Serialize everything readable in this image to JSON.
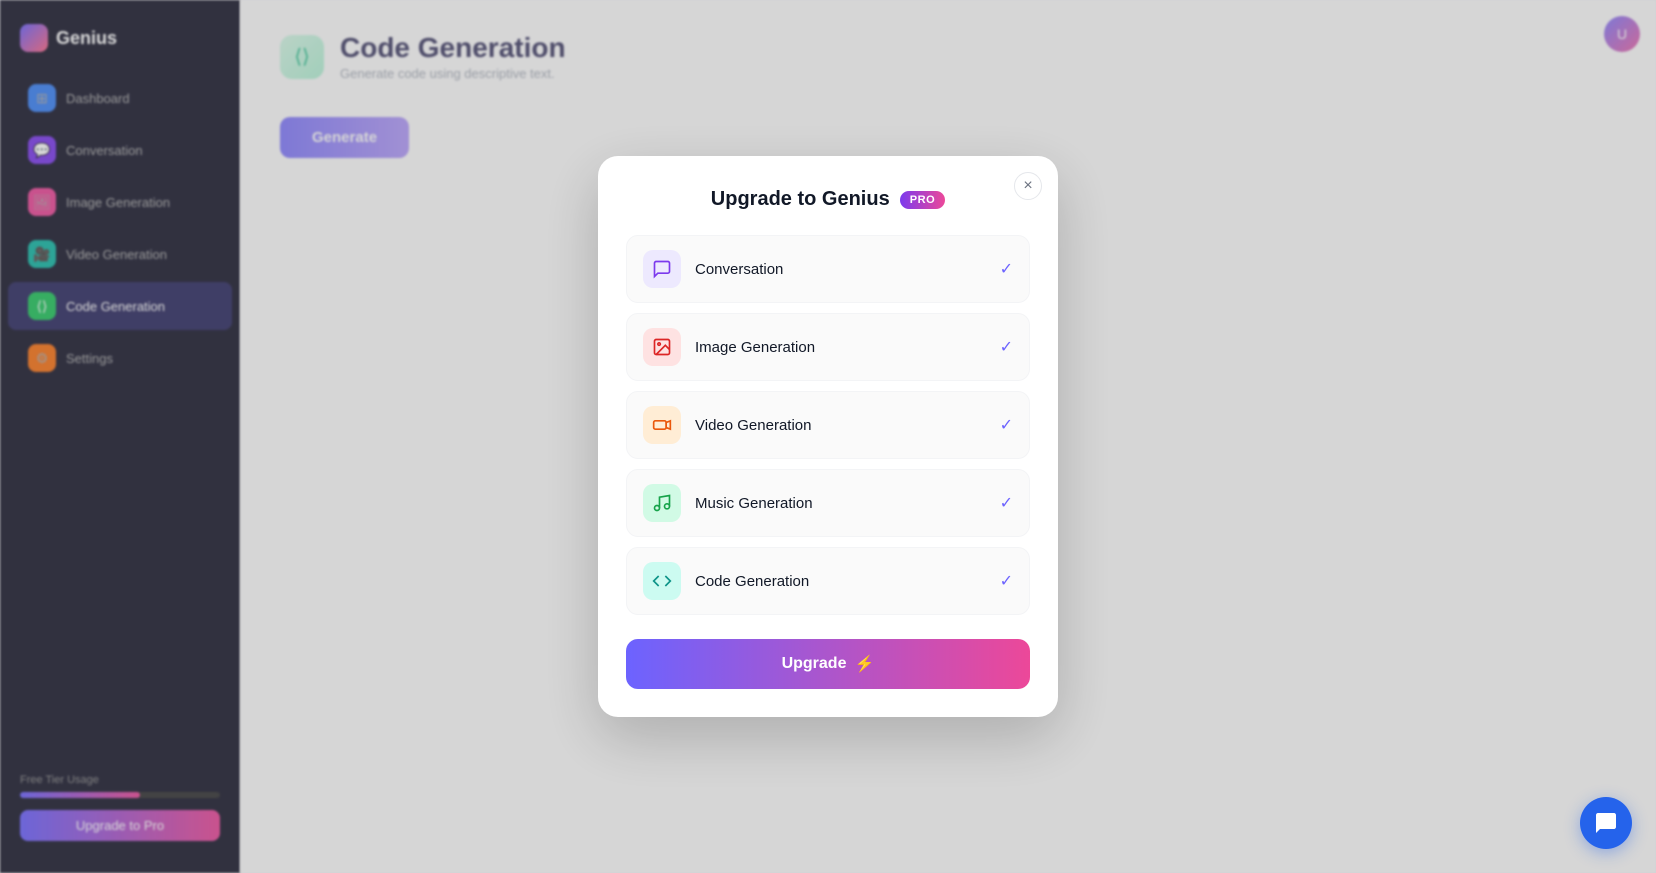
{
  "sidebar": {
    "logo": {
      "text": "Genius"
    },
    "items": [
      {
        "id": "dashboard",
        "label": "Dashboard",
        "color": "dot-blue"
      },
      {
        "id": "conversation",
        "label": "Conversation",
        "color": "dot-purple"
      },
      {
        "id": "image-generation",
        "label": "Image Generation",
        "color": "dot-pink"
      },
      {
        "id": "video-generation",
        "label": "Video Generation",
        "color": "dot-teal"
      },
      {
        "id": "code-generation",
        "label": "Code Generation",
        "color": "dot-green",
        "active": true
      },
      {
        "id": "settings",
        "label": "Settings",
        "color": "dot-orange"
      }
    ],
    "usage_label": "Free Tier Usage",
    "upgrade_label": "Upgrade to Pro"
  },
  "main": {
    "page_title": "Code Generation",
    "page_subtitle": "Generate code using descriptive text.",
    "generate_button_label": "Generate"
  },
  "modal": {
    "title": "Upgrade to Genius",
    "pro_badge": "PRO",
    "close_label": "×",
    "features": [
      {
        "id": "conversation",
        "label": "Conversation",
        "icon": "💬",
        "icon_class": "fi-purple",
        "checked": true
      },
      {
        "id": "image-generation",
        "label": "Image Generation",
        "icon": "🖼",
        "icon_class": "fi-red",
        "checked": true
      },
      {
        "id": "video-generation",
        "label": "Video Generation",
        "icon": "🎥",
        "icon_class": "fi-orange",
        "checked": true
      },
      {
        "id": "music-generation",
        "label": "Music Generation",
        "icon": "🎵",
        "icon_class": "fi-green",
        "checked": true
      },
      {
        "id": "code-generation",
        "label": "Code Generation",
        "icon": "⟨⟩",
        "icon_class": "fi-teal",
        "checked": true
      }
    ],
    "upgrade_button_label": "Upgrade",
    "upgrade_button_icon": "⚡"
  },
  "chat_bubble": {
    "icon": "💬"
  },
  "avatar": {
    "initials": "U"
  }
}
